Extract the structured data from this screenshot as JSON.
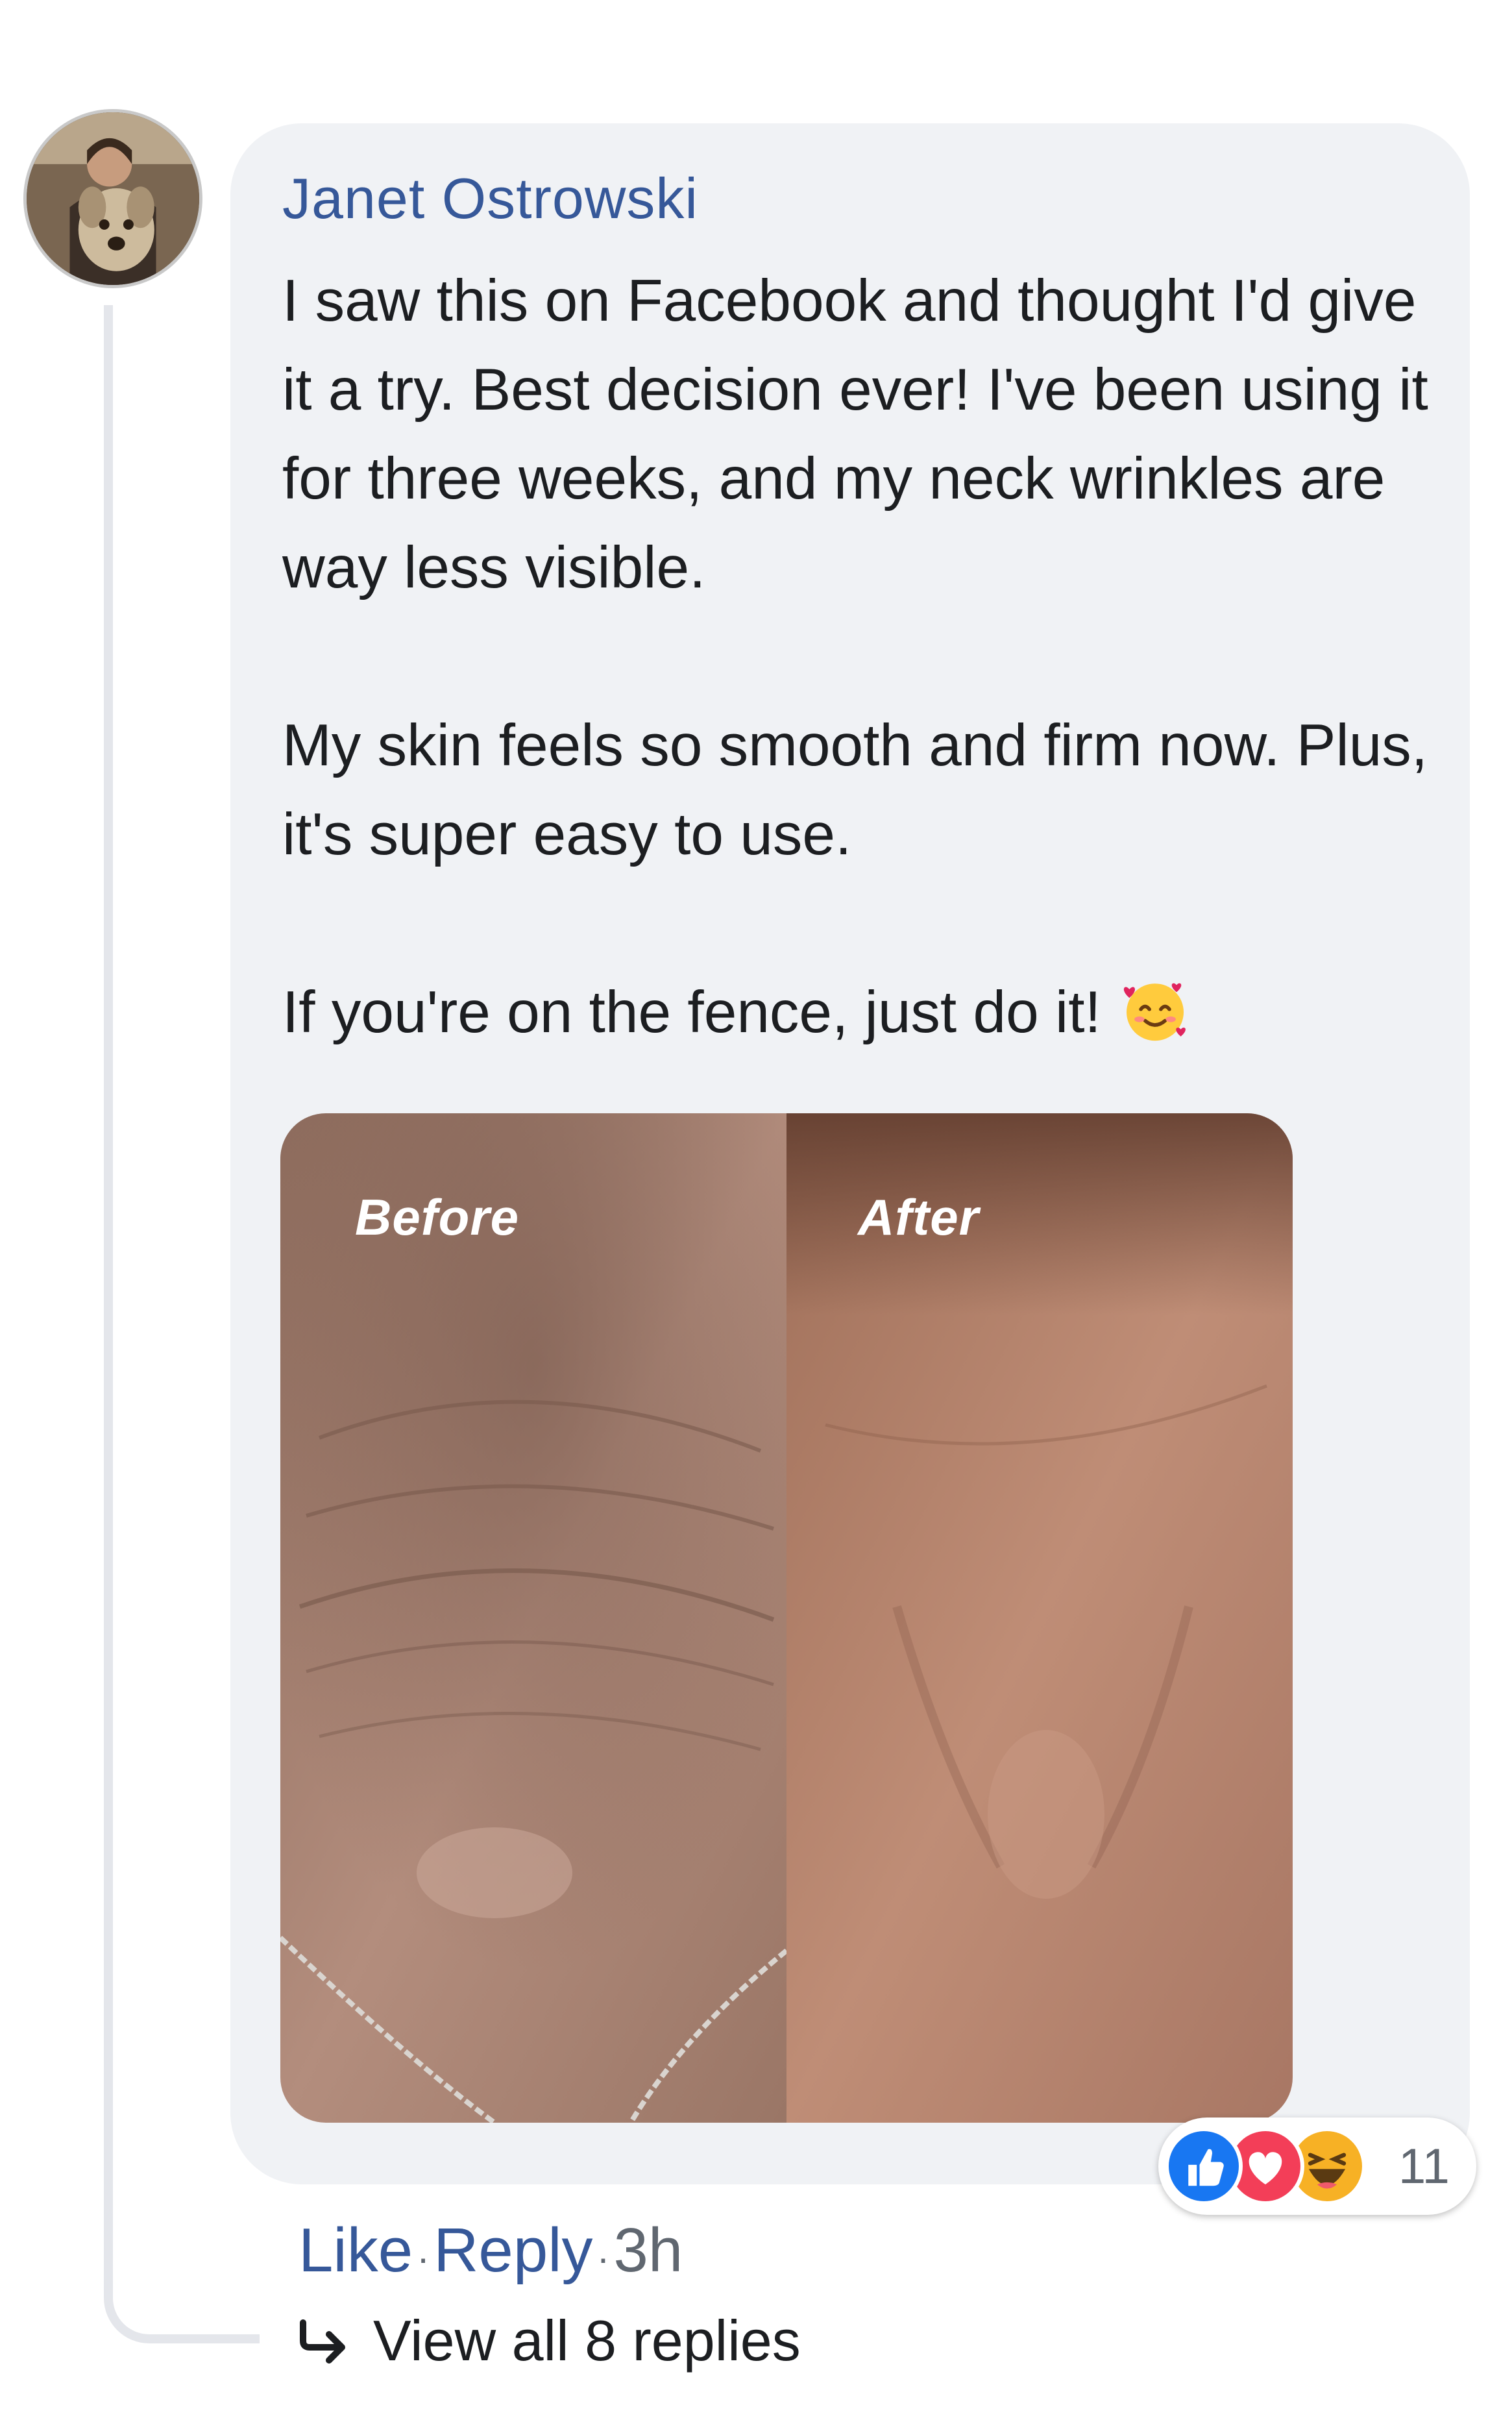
{
  "comment": {
    "author": "Janet Ostrowski",
    "paragraphs": [
      "I saw this on Facebook and thought I'd give it a try. Best decision ever! I've been using it for three weeks, and my neck wrinkles are way less visible.",
      "My skin feels so smooth and firm now. Plus, it's super easy to use.",
      "If you're on the fence, just do it!"
    ],
    "emoji": "smiling-face-with-hearts-icon"
  },
  "photo": {
    "before_label": "Before",
    "after_label": "After"
  },
  "reactions": {
    "icons": [
      "like-icon",
      "love-icon",
      "haha-icon"
    ],
    "count": "11",
    "colors": {
      "like": "#1877f2",
      "love": "#f33e58",
      "haha": "#f7b125"
    }
  },
  "actions": {
    "like": "Like",
    "reply": "Reply",
    "time": "3h"
  },
  "replies": {
    "view_all": "View all 8 replies"
  },
  "colors": {
    "bubble": "#f0f2f5",
    "link": "#365899",
    "text": "#1c1e21",
    "muted": "#606770"
  }
}
